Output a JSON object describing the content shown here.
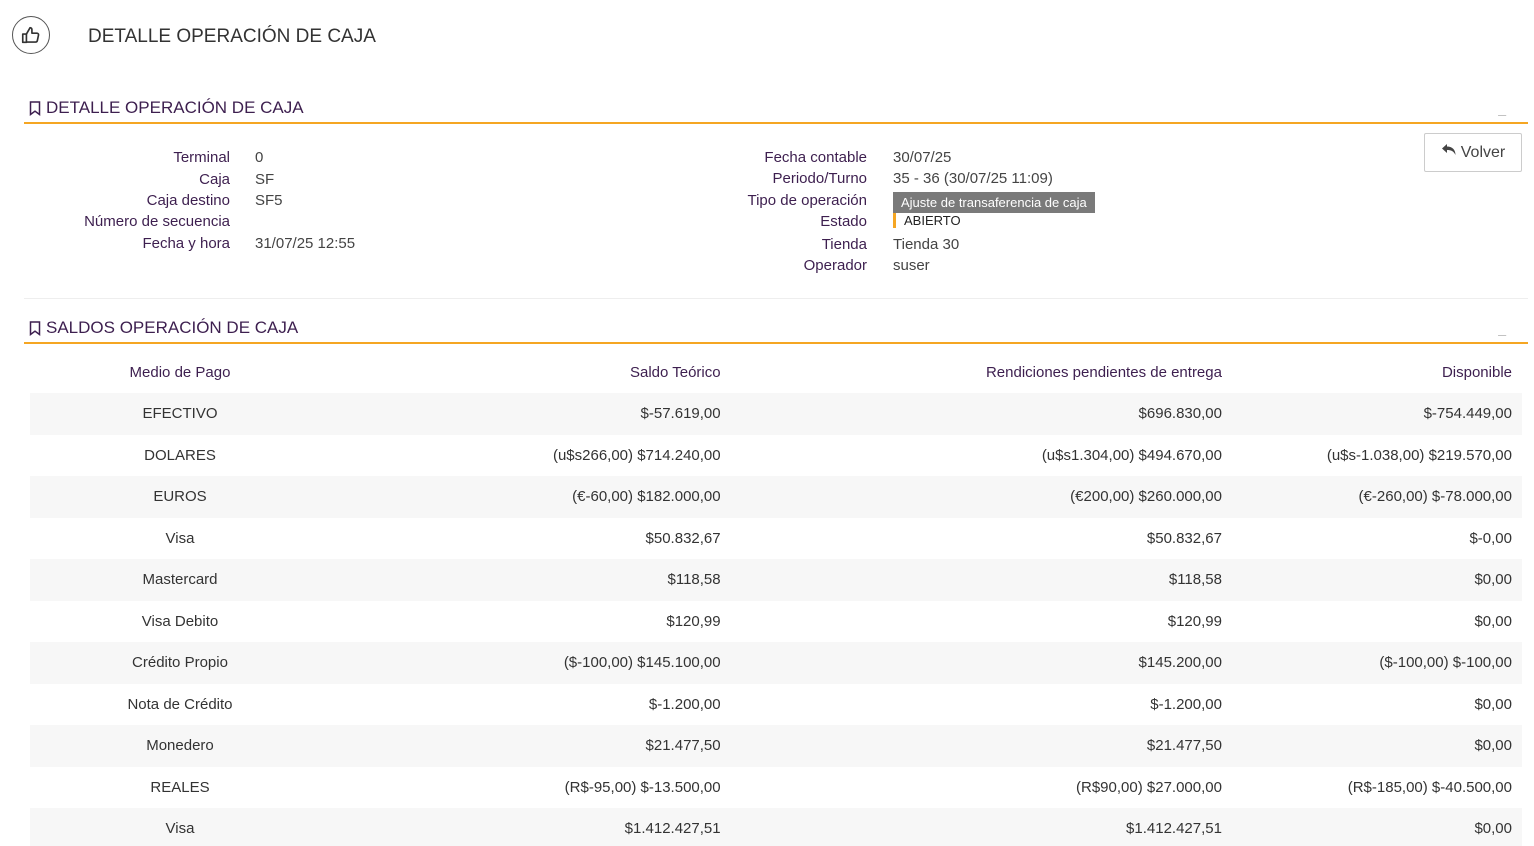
{
  "page": {
    "title": "DETALLE OPERACIÓN DE CAJA"
  },
  "detail_section": {
    "title": "DETALLE OPERACIÓN DE CAJA",
    "minimize": "_",
    "left": [
      {
        "label": "Terminal",
        "value": "0"
      },
      {
        "label": "Caja",
        "value": "SF"
      },
      {
        "label": "Caja destino",
        "value": "SF5"
      },
      {
        "label": "Número de secuencia",
        "value": ""
      },
      {
        "label": "Fecha y hora",
        "value": "31/07/25 12:55"
      }
    ],
    "right": [
      {
        "label": "Fecha contable",
        "value": "30/07/25"
      },
      {
        "label": "Periodo/Turno",
        "value": "35 - 36 (30/07/25 11:09)"
      },
      {
        "label": "Tipo de operación",
        "value": "Ajuste de transaferencia de caja"
      },
      {
        "label": "Estado",
        "value": "ABIERTO"
      },
      {
        "label": "Tienda",
        "value": "Tienda 30"
      },
      {
        "label": "Operador",
        "value": "suser"
      }
    ],
    "back_button": "Volver"
  },
  "saldos_section": {
    "title": "SALDOS OPERACIÓN DE CAJA",
    "minimize": "_",
    "columns": [
      "Medio de Pago",
      "Saldo Teórico",
      "Rendiciones pendientes de entrega",
      "Disponible"
    ],
    "rows": [
      [
        "EFECTIVO",
        "$-57.619,00",
        "$696.830,00",
        "$-754.449,00"
      ],
      [
        "DOLARES",
        "(u$s266,00) $714.240,00",
        "(u$s1.304,00) $494.670,00",
        "(u$s-1.038,00) $219.570,00"
      ],
      [
        "EUROS",
        "(€-60,00) $182.000,00",
        "(€200,00) $260.000,00",
        "(€-260,00) $-78.000,00"
      ],
      [
        "Visa",
        "$50.832,67",
        "$50.832,67",
        "$-0,00"
      ],
      [
        "Mastercard",
        "$118,58",
        "$118,58",
        "$0,00"
      ],
      [
        "Visa Debito",
        "$120,99",
        "$120,99",
        "$0,00"
      ],
      [
        "Crédito Propio",
        "($-100,00) $145.100,00",
        "$145.200,00",
        "($-100,00) $-100,00"
      ],
      [
        "Nota de Crédito",
        "$-1.200,00",
        "$-1.200,00",
        "$0,00"
      ],
      [
        "Monedero",
        "$21.477,50",
        "$21.477,50",
        "$0,00"
      ],
      [
        "REALES",
        "(R$-95,00) $-13.500,00",
        "(R$90,00) $27.000,00",
        "(R$-185,00) $-40.500,00"
      ],
      [
        "Visa",
        "$1.412.427,51",
        "$1.412.427,51",
        "$0,00"
      ]
    ]
  }
}
